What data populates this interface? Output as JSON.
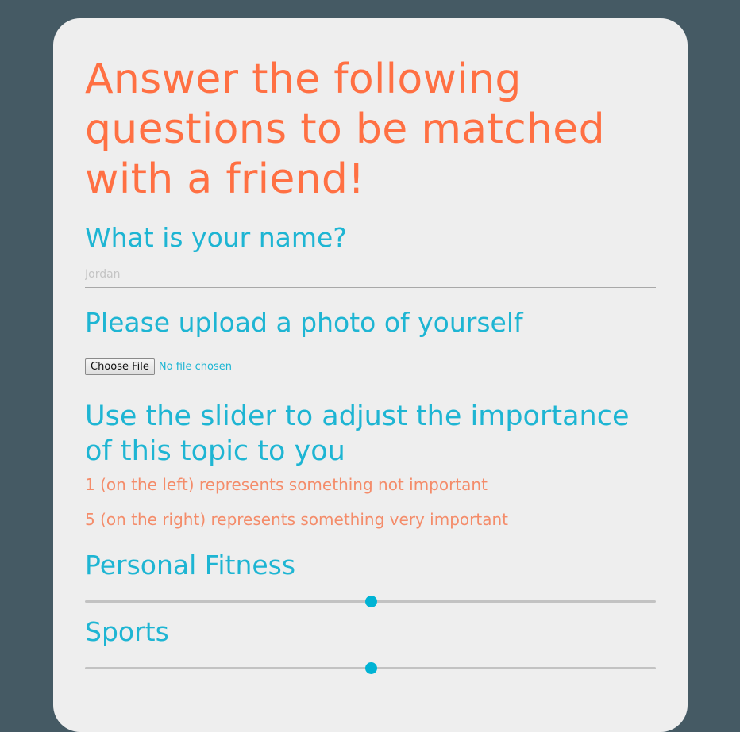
{
  "form": {
    "title": "Answer the following questions to be matched with a friend!",
    "name_question": "What is your name?",
    "name_placeholder": "Jordan",
    "photo_question": "Please upload a photo of yourself",
    "file_button": "Choose File",
    "file_status": "No file chosen",
    "slider_question": "Use the slider to adjust the importance of this topic to you",
    "note_low": "1 (on the left) represents something not important",
    "note_high": "5 (on the right) represents something very important",
    "topics": [
      {
        "label": "Personal Fitness",
        "value": 3,
        "min": 1,
        "max": 5
      },
      {
        "label": "Sports",
        "value": 3,
        "min": 1,
        "max": 5
      }
    ]
  },
  "colors": {
    "background": "#455a64",
    "card": "#eeeeee",
    "title": "#ff7043",
    "question": "#1eb5d3",
    "note": "#f48c6a",
    "slider_thumb": "#00b3d4"
  }
}
